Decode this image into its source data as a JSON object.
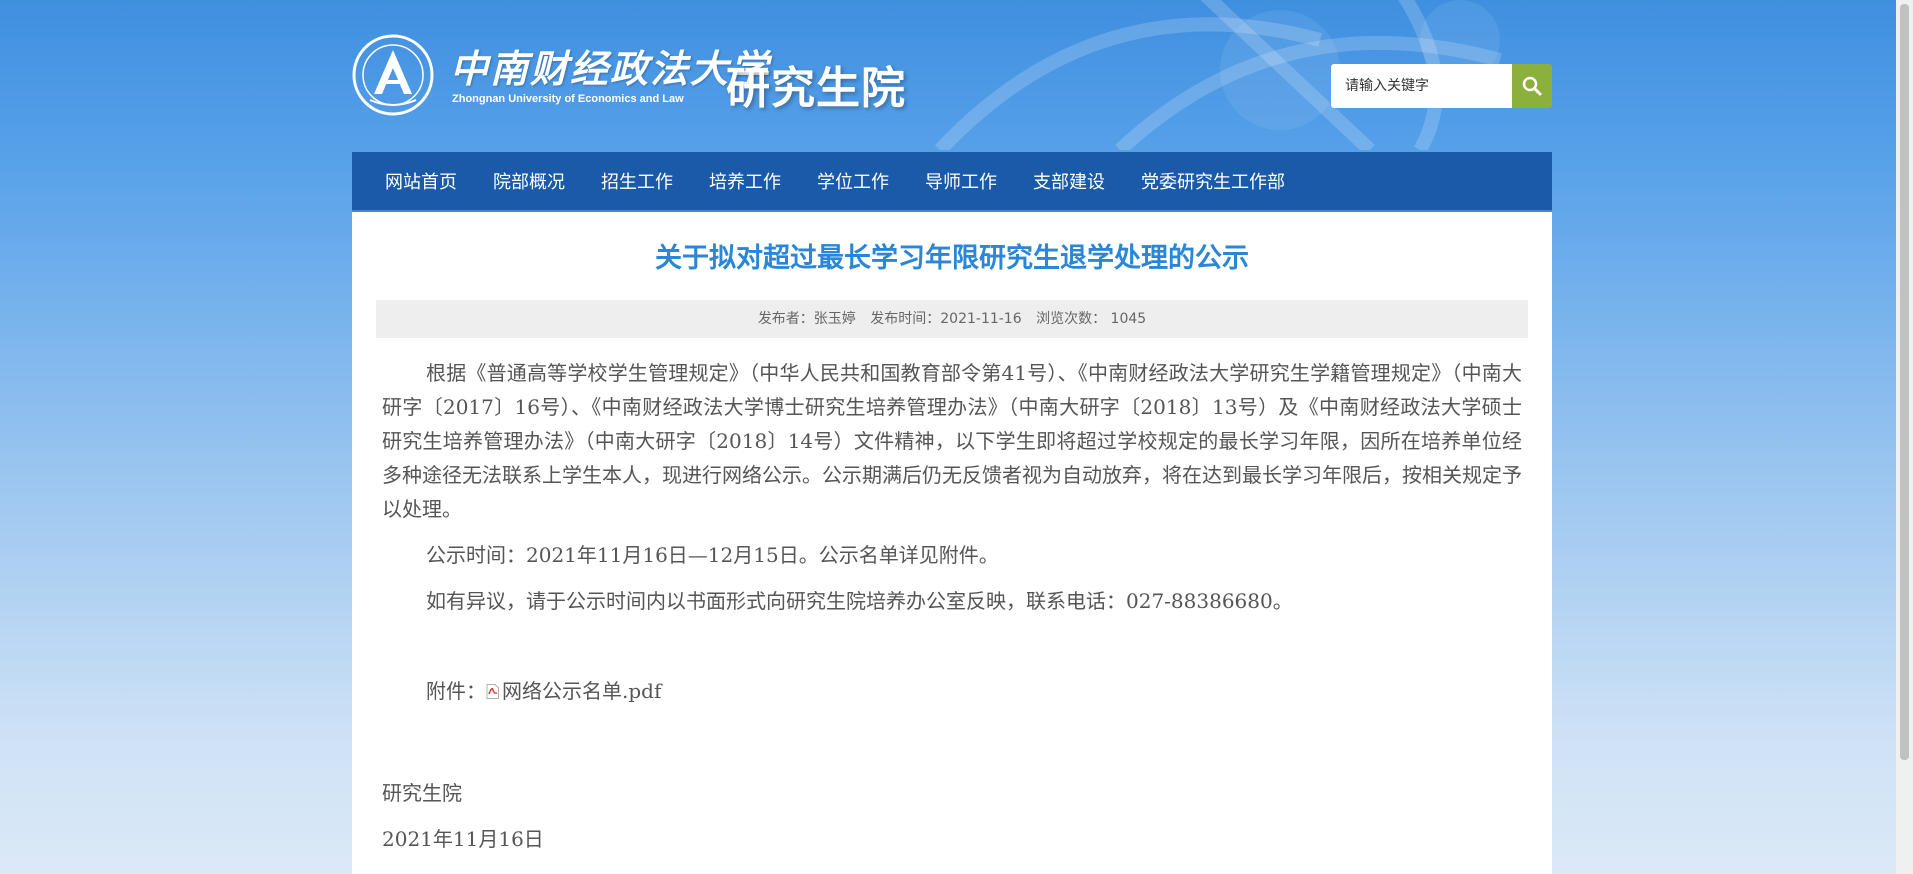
{
  "header": {
    "logo_cn": "中南财经政法大学",
    "logo_en": "Zhongnan University of Economics and Law",
    "site_name": "研究生院",
    "search_placeholder": "请输入关键字"
  },
  "nav": {
    "items": [
      "网站首页",
      "院部概况",
      "招生工作",
      "培养工作",
      "学位工作",
      "导师工作",
      "支部建设",
      "党委研究生工作部"
    ]
  },
  "article": {
    "title": "关于拟对超过最长学习年限研究生退学处理的公示",
    "meta": {
      "publisher": "发布者：张玉婷",
      "date": "发布时间：2021-11-16",
      "views": "浏览次数： 1045"
    },
    "paragraphs": [
      "根据《普通高等学校学生管理规定》（中华人民共和国教育部令第41号）、《中南财经政法大学研究生学籍管理规定》（中南大研字〔2017〕16号）、《中南财经政法大学博士研究生培养管理办法》（中南大研字〔2018〕13号）及《中南财经政法大学硕士研究生培养管理办法》（中南大研字〔2018〕14号）文件精神，以下学生即将超过学校规定的最长学习年限，因所在培养单位经多种途径无法联系上学生本人，现进行网络公示。公示期满后仍无反馈者视为自动放弃，将在达到最长学习年限后，按相关规定予以处理。",
      "公示时间：2021年11月16日—12月15日。公示名单详见附件。",
      "如有异议，请于公示时间内以书面形式向研究生院培养办公室反映，联系电话：027-88386680。"
    ],
    "attachment_label": "附件：",
    "attachment_name": "网络公示名单.pdf",
    "signature_org": "研究生院",
    "signature_date": "2021年11月16日"
  },
  "colors": {
    "nav_bg": "#1a5aa8",
    "title": "#2a86d6",
    "search_button": "#8bb03b"
  },
  "icons": {
    "search": "search-icon",
    "attachment": "pdf-file-icon",
    "emblem": "university-emblem-icon"
  }
}
